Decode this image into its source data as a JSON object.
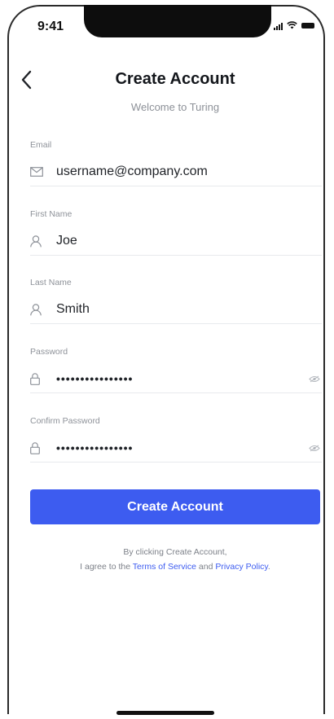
{
  "status_bar": {
    "time": "9:41"
  },
  "header": {
    "title": "Create Account",
    "subtitle": "Welcome to Turing"
  },
  "form": {
    "email": {
      "label": "Email",
      "value": "username@company.com",
      "icon": "mail-icon"
    },
    "first_name": {
      "label": "First Name",
      "value": "Joe",
      "icon": "user-icon"
    },
    "last_name": {
      "label": "Last Name",
      "value": "Smith",
      "icon": "user-icon"
    },
    "password": {
      "label": "Password",
      "value": "••••••••••••••••",
      "icon": "lock-icon"
    },
    "confirm_password": {
      "label": "Confirm Password",
      "value": "••••••••••••••••",
      "icon": "lock-icon"
    }
  },
  "actions": {
    "create_account_label": "Create Account"
  },
  "legal": {
    "line1": "By clicking Create Account,",
    "prefix": "I agree to the ",
    "terms_label": "Terms of Service",
    "conjunction": " and ",
    "privacy_label": "Privacy Policy",
    "suffix": "."
  },
  "colors": {
    "accent": "#3d5cf0",
    "muted_text": "#8e9299",
    "divider": "#e8eaed"
  }
}
